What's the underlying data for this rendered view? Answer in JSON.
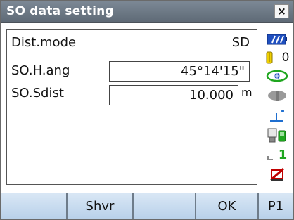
{
  "window": {
    "title": "SO data setting",
    "close_label": "×"
  },
  "fields": {
    "dist_mode": {
      "label": "Dist.mode",
      "value": "SD"
    },
    "so_h_ang": {
      "label": "SO.H.ang",
      "value": "45°14'15\""
    },
    "so_sdist": {
      "label": "SO.Sdist",
      "value": "10.000",
      "unit": "m"
    }
  },
  "status": {
    "count_value": "0",
    "page_number": "1"
  },
  "softkeys": [
    "",
    "Shvr",
    "",
    "OK",
    "P1"
  ],
  "colors": {
    "title_bar": "#6b7682",
    "softkey": "#c8dcf0",
    "accent_blue": "#1f4fbf",
    "accent_green": "#1fa61f"
  }
}
